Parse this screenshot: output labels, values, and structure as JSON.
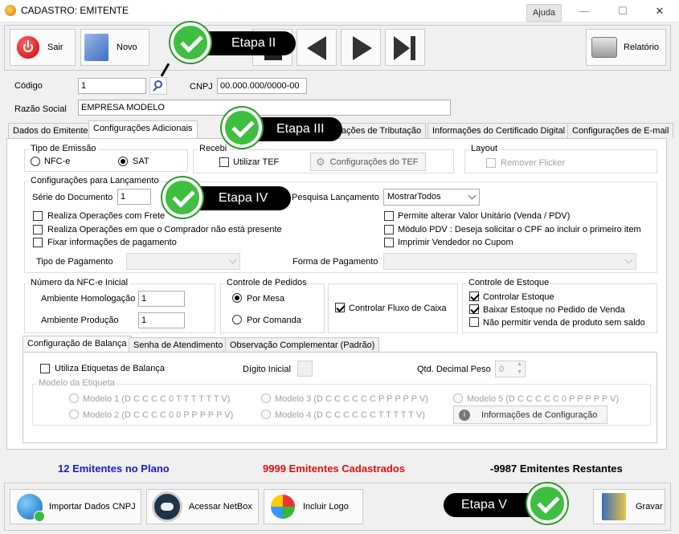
{
  "window": {
    "title": "CADASTRO: EMITENTE",
    "help_label": "Ajuda"
  },
  "toolbar": {
    "exit_label": "Sair",
    "new_label": "Novo",
    "report_label": "Relatório"
  },
  "header": {
    "code_label": "Código",
    "code_value": "1",
    "cnpj_label": "CNPJ",
    "cnpj_value": "00.000.000/0000-00",
    "razao_label": "Razão Social",
    "razao_value": "EMPRESA MODELO"
  },
  "tabs": [
    {
      "label": "Dados do Emitente"
    },
    {
      "label": "Configurações Adicionais"
    },
    {
      "label": "ações de Tributação"
    },
    {
      "label": "Informações do Certificado Digital"
    },
    {
      "label": "Configurações de E-mail"
    }
  ],
  "emissao": {
    "caption": "Tipo de Emissão",
    "opt_nfce": "NFC-e",
    "opt_sat": "SAT",
    "selected": "SAT"
  },
  "receb": {
    "caption": "Recebi",
    "use_tef": "Utilizar TEF",
    "tef_config": "Configurações do TEF"
  },
  "layout": {
    "caption": "Layout",
    "remove_flicker": "Remover Flicker"
  },
  "lanc": {
    "caption": "Configurações para Lançamento",
    "serie_label": "Série do Documento",
    "serie_value": "1",
    "pesquisa_label": "Pesquisa Lançamento",
    "pesquisa_value": "MostrarTodos",
    "opts_left": [
      "Realiza Operações com Frete",
      "Realiza Operações em que o Comprador não está presente",
      "Fixar informações de pagamento"
    ],
    "opts_right": [
      "Permite alterar Valor Unitário (Venda / PDV)",
      "Módulo PDV : Deseja solicitar o CPF ao incluir o primeiro item",
      "Imprimir Vendedor no Cupom"
    ],
    "tipo_pag_label": "Tipo de Pagamento",
    "forma_pag_label": "Forma de Pagamento"
  },
  "nfce_num": {
    "caption": "Número da NFC-e Inicial",
    "homolog_label": "Ambiente Homologação",
    "homolog_value": "1",
    "prod_label": "Ambiente Produção",
    "prod_value": "1"
  },
  "pedidos": {
    "caption": "Controle de Pedidos",
    "opt_mesa": "Por Mesa",
    "opt_comanda": "Por Comanda",
    "selected": "Por Mesa"
  },
  "fluxo": {
    "label": "Controlar Fluxo de Caixa",
    "checked": true
  },
  "estoque": {
    "caption": "Controle de Estoque",
    "opt1": "Controlar Estoque",
    "opt1_checked": true,
    "opt2": "Baixar Estoque no Pedido de Venda",
    "opt2_checked": true,
    "opt3": "Não permitir venda de produto sem saldo",
    "opt3_checked": false
  },
  "subtabs": [
    {
      "label": "Configuração de Balança"
    },
    {
      "label": "Senha de Atendimento"
    },
    {
      "label": "Observação Complementar (Padrão)"
    }
  ],
  "balanca": {
    "use_label": "Utiliza Etiquetas de Balança",
    "digito_label": "Dígito Inicial",
    "qtd_label": "Qtd. Decimal Peso",
    "qtd_value": "0",
    "modelo_caption": "Modelo da Etiqueta",
    "modelos": [
      "Modelo 1 (D C C C C 0 T T T T T T V)",
      "Modelo 2 (D C C C C 0 0 P P P P P V)",
      "Modelo 3 (D C C C C C C P P P P P V)",
      "Modelo 4 (D C C C C C C T T T T T V)",
      "Modelo 5 (D C C C C C 0 P P P P P V)"
    ],
    "info_label": "Informações de Configuração"
  },
  "stats": {
    "plan": "12 Emitentes no Plano",
    "plan_color": "#1a1ad0",
    "registered": "9999 Emitentes Cadastrados",
    "registered_color": "#e01010",
    "remaining": "-9987 Emitentes Restantes",
    "remaining_color": "#000000"
  },
  "bottom": {
    "import_label": "Importar Dados CNPJ",
    "netbox_label": "Acessar NetBox",
    "logo_label": "Incluir Logo",
    "save_label": "Gravar"
  },
  "steps": {
    "s2": "Etapa II",
    "s3": "Etapa III",
    "s4": "Etapa IV",
    "s5": "Etapa V"
  },
  "colors": {
    "step_bg": "#000000",
    "step_check": "#3fbf3f"
  }
}
